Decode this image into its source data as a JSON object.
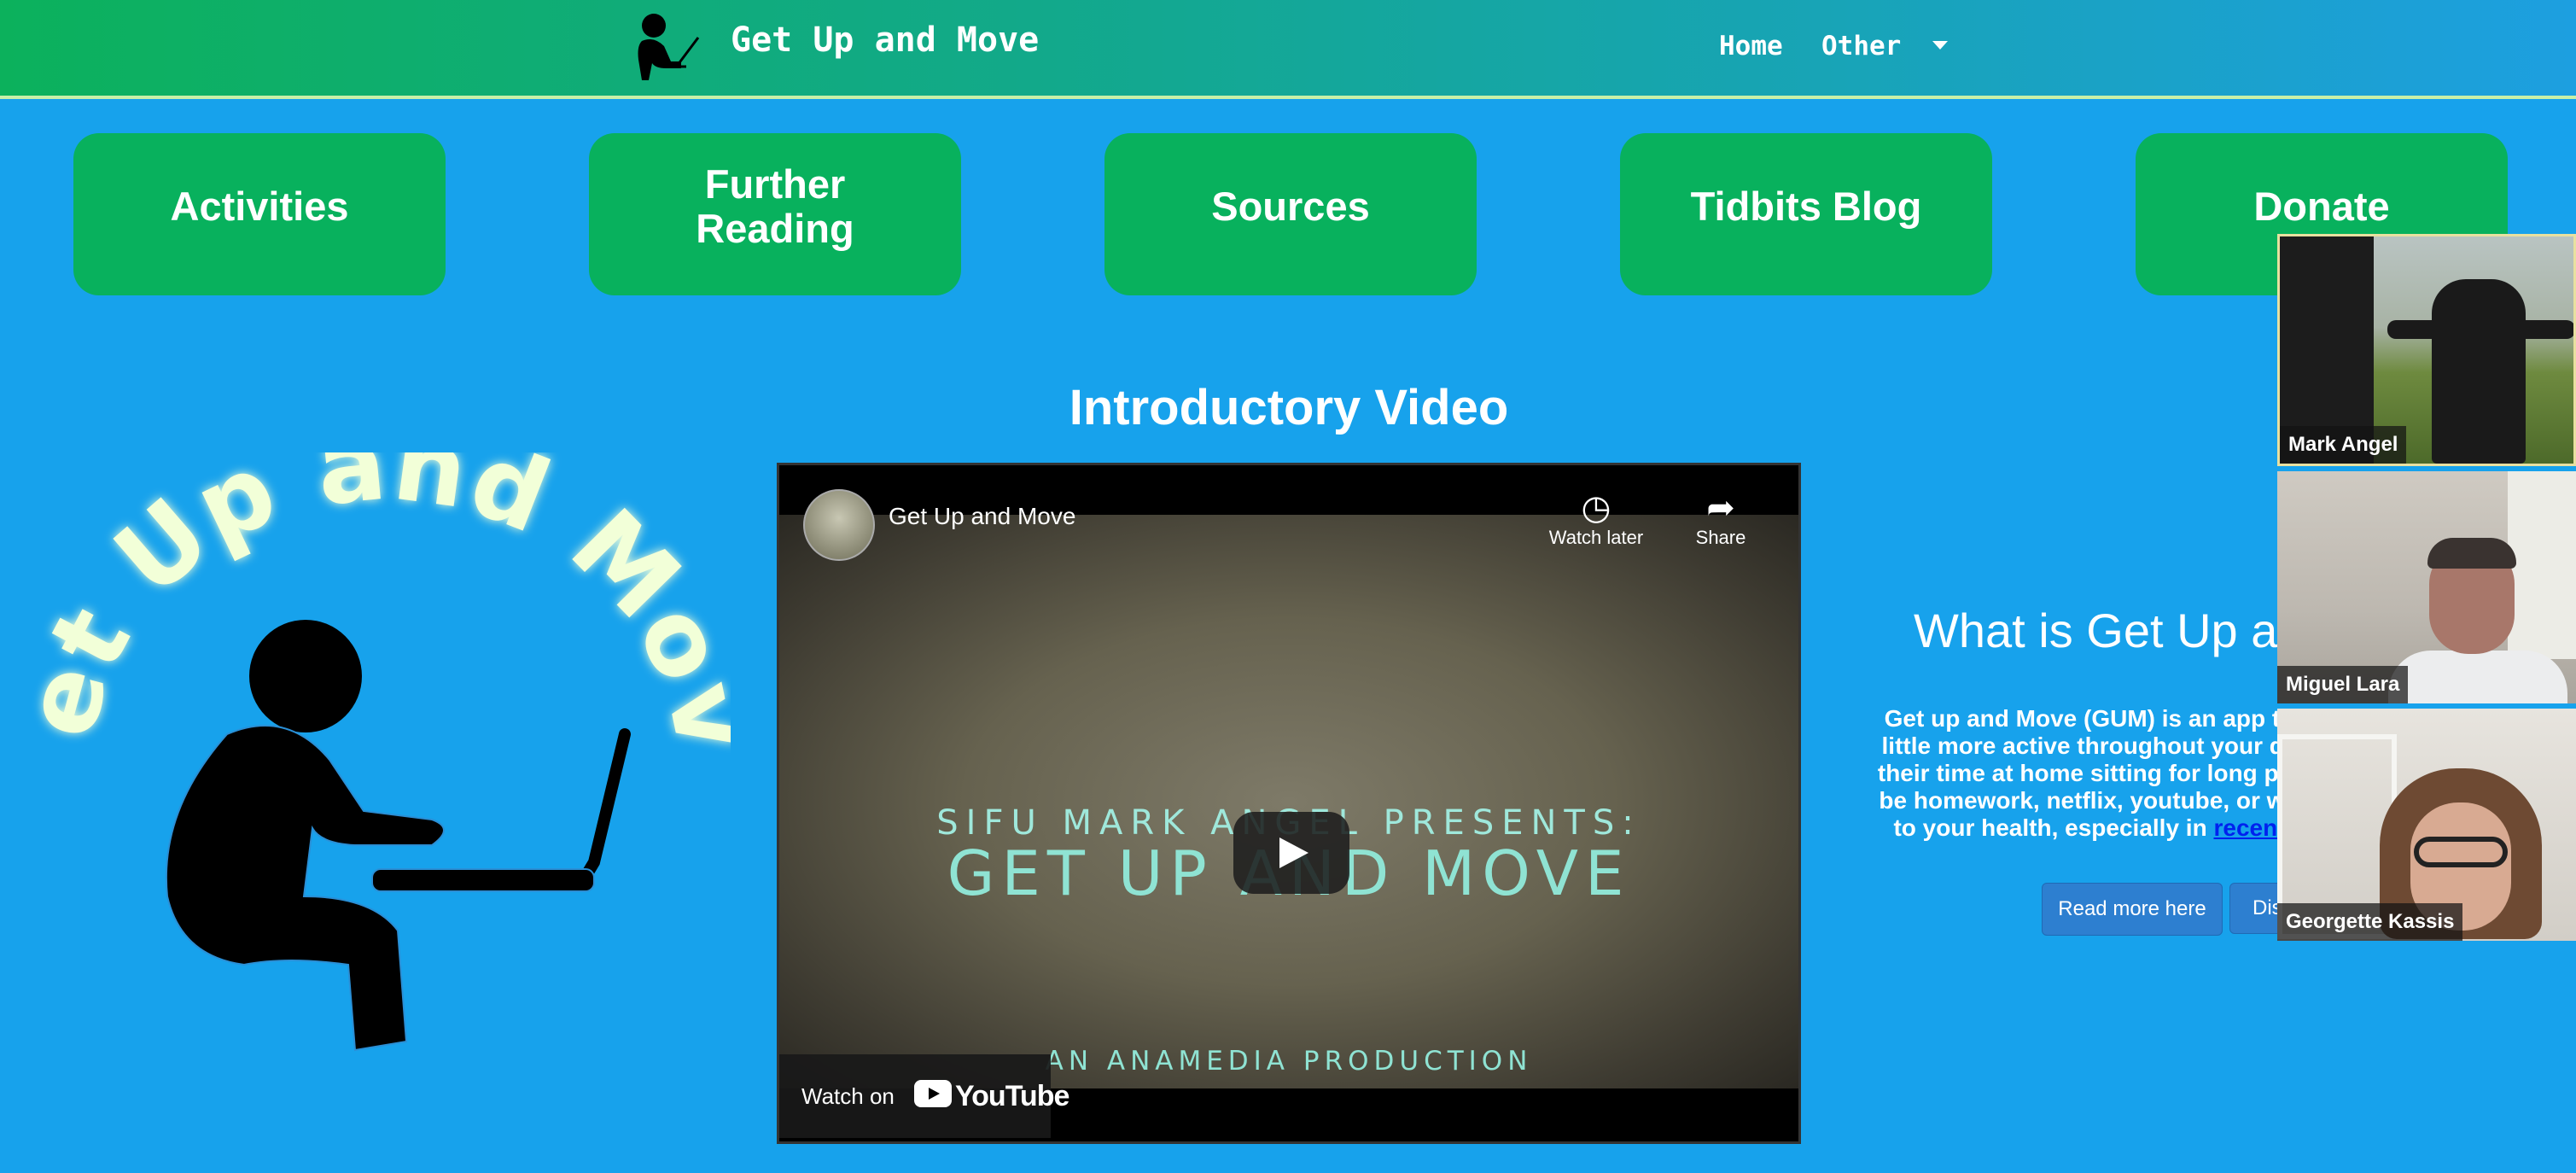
{
  "navbar": {
    "brand_title": "Get Up and Move",
    "links": [
      {
        "label": "Home"
      },
      {
        "label": "Other"
      }
    ]
  },
  "tiles": [
    {
      "label": "Activities"
    },
    {
      "label": "Further Reading"
    },
    {
      "label": "Sources"
    },
    {
      "label": "Tidbits Blog"
    },
    {
      "label": "Donate"
    }
  ],
  "intro": {
    "title": "Introductory Video"
  },
  "video": {
    "title": "Get Up and Move",
    "watch_later": "Watch later",
    "share": "Share",
    "line1": "SIFU MARK ANGEL PRESENTS:",
    "line2": "GET UP AND MOVE",
    "line3": "AN ANAMEDIA PRODUCTION",
    "watch_on": "Watch on",
    "youtube": "YouTube",
    "icons": {
      "watch_later": "clock-icon",
      "share": "share-arrow-icon",
      "play": "play-icon"
    }
  },
  "logo": {
    "arc_text": "Get Up and Move"
  },
  "about": {
    "title": "What is Get Up a",
    "body_lines": [
      "Get up and Move (GUM) is an app th",
      "little more active throughout your da",
      "their time at home sitting for long per",
      "be homework, netflix, youtube, or wo",
      "to your health, especially in "
    ],
    "link_text": "recent",
    "read_more": "Read more here",
    "second_button": "Dis"
  },
  "participants": [
    {
      "name": "Mark Angel"
    },
    {
      "name": "Miguel Lara"
    },
    {
      "name": "Georgette Kassis"
    }
  ],
  "colors": {
    "background": "#17a2ec",
    "tile": "#08b15d",
    "nav_start": "#0cb15c",
    "nav_end": "#1d9fe0",
    "glow_text": "#f2ffd8"
  }
}
